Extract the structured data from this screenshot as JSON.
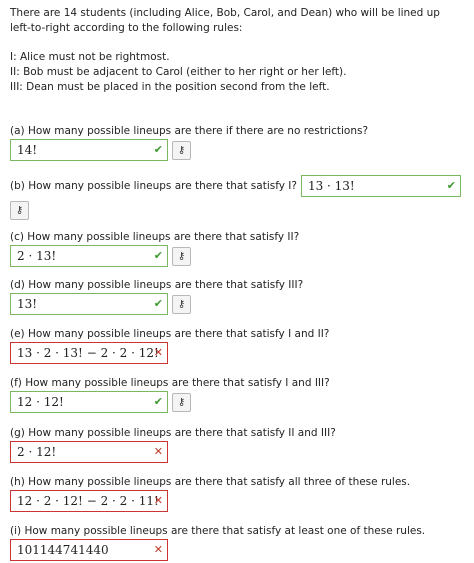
{
  "intro": {
    "line1": "There are 14 students (including Alice, Bob, Carol, and Dean) who will be lined up",
    "line2": "left-to-right according to the following rules:",
    "rule1": "I: Alice must not be rightmost.",
    "rule2": "II: Bob must be adjacent to Carol (either to her right or her left).",
    "rule3": "III: Dean must be placed in the position second from the left."
  },
  "questions": [
    {
      "text": "(a) How many possible lineups are there if there are no restrictions?",
      "answer": "14!",
      "status": "correct"
    },
    {
      "text": "(b) How many possible lineups are there that satisfy I?",
      "answer": "13 · 13!",
      "status": "correct"
    },
    {
      "text": "(c) How many possible lineups are there that satisfy II?",
      "answer": "2 · 13!",
      "status": "correct"
    },
    {
      "text": "(d) How many possible lineups are there that satisfy III?",
      "answer": "13!",
      "status": "correct"
    },
    {
      "text": "(e) How many possible lineups are there that satisfy I and II?",
      "answer": "13 · 2 · 13! − 2 · 2 · 12!",
      "status": "incorrect"
    },
    {
      "text": "(f) How many possible lineups are there that satisfy I and III?",
      "answer": "12 · 12!",
      "status": "correct"
    },
    {
      "text": "(g) How many possible lineups are there that satisfy II and III?",
      "answer": "2 · 12!",
      "status": "incorrect"
    },
    {
      "text": "(h) How many possible lineups are there that satisfy all three of these rules.",
      "answer": "12 · 2 · 12! − 2 · 2 · 11!",
      "status": "incorrect"
    },
    {
      "text": "(i) How many possible lineups are there that satisfy at least one of these rules.",
      "answer": "101144741440",
      "status": "incorrect"
    }
  ],
  "icons": {
    "correct": "check-icon",
    "incorrect": "x-icon",
    "key": "key-icon"
  },
  "colors": {
    "correct": "#7bb661",
    "incorrect": "#cc3333"
  }
}
